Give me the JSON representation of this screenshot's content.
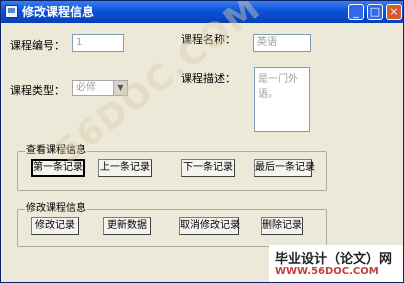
{
  "window": {
    "title": "修改课程信息",
    "controls": {
      "min": "_",
      "max": "□",
      "close": "×"
    }
  },
  "form": {
    "course_id": {
      "label": "课程编号：",
      "value": "1"
    },
    "course_name": {
      "label": "课程名称：",
      "value": "英语"
    },
    "course_type": {
      "label": "课程类型：",
      "value": "必修"
    },
    "course_desc": {
      "label": "课程描述：",
      "value": "是一门外语。"
    }
  },
  "view_group": {
    "title": "查看课程信息",
    "buttons": {
      "first": "第一条记录",
      "prev": "上一条记录",
      "next": "下一条记录",
      "last": "最后一条记录"
    }
  },
  "edit_group": {
    "title": "修改课程信息",
    "buttons": {
      "modify": "修改记录",
      "update": "更新数据",
      "cancel": "取消修改记录",
      "delete": "删除记录"
    }
  },
  "watermarks": {
    "diagonal": "56DOC.COM",
    "brand": "毕业设计（论文）网",
    "url": "WWW.56DOC.COM"
  },
  "colors": {
    "titlebar": "#0a52d8",
    "window_bg": "#ece9d8",
    "watermark_url": "#c3413a"
  }
}
